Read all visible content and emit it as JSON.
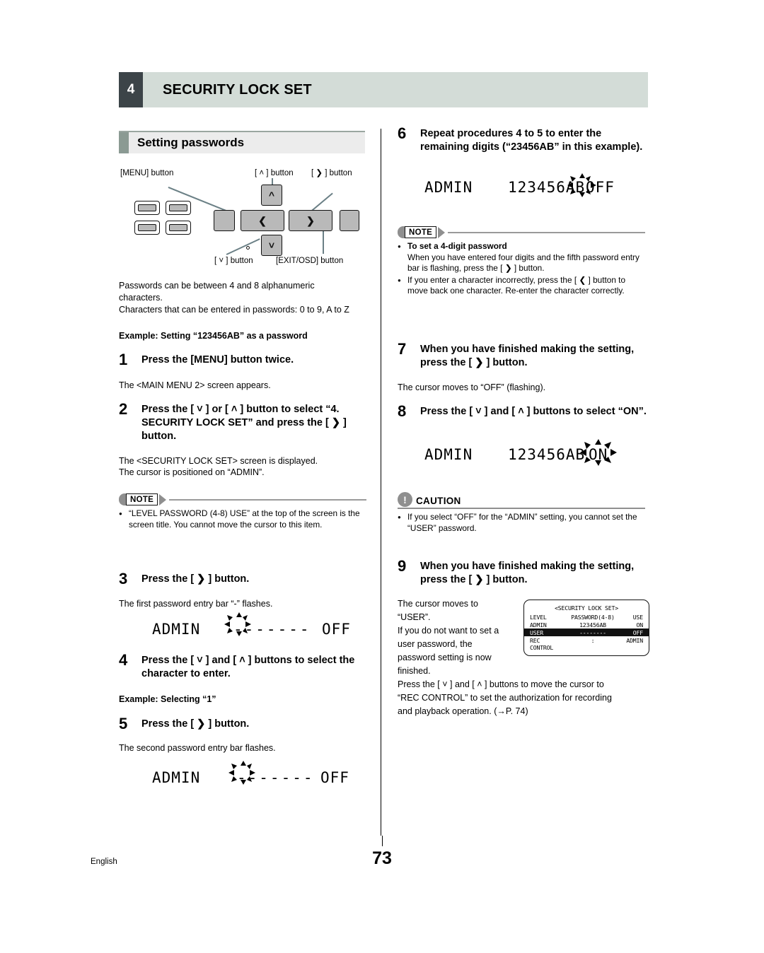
{
  "header": {
    "number": "4",
    "title": "SECURITY LOCK SET"
  },
  "section": {
    "title": "Setting passwords"
  },
  "remote_labels": {
    "menu": "[MENU] button",
    "up": "[ ˄ ] button",
    "right": "[ ❯ ] button",
    "down": "[ ˅ ] button",
    "exit": "[EXIT/OSD] button"
  },
  "intro": {
    "line1": "Passwords can be between 4 and 8 alphanumeric",
    "line2": "characters.",
    "line3": "Characters that can be entered in passwords: 0 to 9, A to Z",
    "example": "Example: Setting “123456AB” as a password"
  },
  "steps": {
    "s1": {
      "num": "1",
      "text": "Press the [MENU] button twice.",
      "body": "The <MAIN MENU 2> screen appears."
    },
    "s2": {
      "num": "2",
      "text": "Press the [ ˅ ] or [ ˄ ] button to select “4. SECURITY LOCK SET” and press the [ ❯ ] button.",
      "body1": "The <SECURITY LOCK SET> screen is displayed.",
      "body2": "The cursor is positioned on “ADMIN”."
    },
    "s3": {
      "num": "3",
      "text": "Press the [ ❯ ] button.",
      "body": "The first password entry bar “-” flashes."
    },
    "s4": {
      "num": "4",
      "text": "Press the [ ˅ ] and [ ˄ ] buttons to select the character to enter.",
      "example": "Example: Selecting “1”"
    },
    "s5": {
      "num": "5",
      "text": "Press the [ ❯ ] button.",
      "body": "The second password entry bar flashes."
    },
    "s6": {
      "num": "6",
      "text": "Repeat procedures 4 to 5 to enter the remaining digits (“23456AB” in this example)."
    },
    "s7": {
      "num": "7",
      "text": "When you have finished making the setting, press the [ ❯ ] button.",
      "body": "The cursor moves to “OFF” (flashing)."
    },
    "s8": {
      "num": "8",
      "text": "Press the [ ˅ ] and [ ˄ ] buttons to select “ON”."
    },
    "s9": {
      "num": "9",
      "text": "When you have finished making the setting, press the [ ❯ ] button.",
      "body1": "The cursor moves to",
      "body2": "“USER”.",
      "body3": "If you do not want to set a",
      "body4": "user password, the",
      "body5": "password setting is now",
      "body6": "finished.",
      "body7": "Press the [ ˅ ] and [ ˄ ] buttons to move the cursor to",
      "body8": "“REC CONTROL” to set the authorization for recording",
      "body9": "and playback operation. (→P. 74)"
    }
  },
  "notes": {
    "left": {
      "tag": "NOTE",
      "items": [
        "“LEVEL PASSWORD (4-8) USE” at the top of the screen is the screen title. You cannot move the cursor to this item."
      ]
    },
    "right": {
      "tag": "NOTE",
      "item1_title": "To set a 4-digit password",
      "item1_body": "When you have entered four digits and the fifth password entry bar is flashing, press the [ ❯ ] button.",
      "item2": "If you enter a character incorrectly, press the [ ❮ ] button to move back one character. Re-enter the character correctly."
    }
  },
  "caution": {
    "tag": "CAUTION",
    "items": [
      "If you select “OFF” for the “ADMIN” setting, you cannot set the “USER” password."
    ]
  },
  "displays": {
    "d3": {
      "label": "ADMIN",
      "chars": "-------",
      "value": "OFF",
      "flash_index": 0
    },
    "d5": {
      "label": "ADMIN",
      "chars": "-------",
      "value": "OFF",
      "flash_index": 1
    },
    "d6": {
      "label": "ADMIN",
      "chars": "123456AB",
      "value": "OFF",
      "flash_index": 7
    },
    "d8": {
      "label": "ADMIN",
      "chars": "123456AB",
      "value": "ON",
      "flash_value": true
    }
  },
  "osd": {
    "title": "<SECURITY LOCK SET>",
    "rows": [
      {
        "c1": "LEVEL",
        "c2": "PASSWORD(4-8)",
        "c3": "USE",
        "highlight": false
      },
      {
        "c1": "ADMIN",
        "c2": "123456AB",
        "c3": "ON",
        "highlight": false
      },
      {
        "c1": "USER",
        "c2": "--------",
        "c3": "OFF",
        "highlight": true
      },
      {
        "c1": "REC CONTROL",
        "c2": ":",
        "c3": "ADMIN",
        "highlight": false
      }
    ]
  },
  "footer": {
    "language": "English",
    "page": "73"
  },
  "colors": {
    "header_block": "#3c4448",
    "header_bar": "#d3dcd7",
    "section_block": "#8b9a93",
    "section_bar": "#ececec",
    "note_gray": "#8f8f8f",
    "button_gray": "#b9b9b9",
    "leader": "#6b8086"
  }
}
